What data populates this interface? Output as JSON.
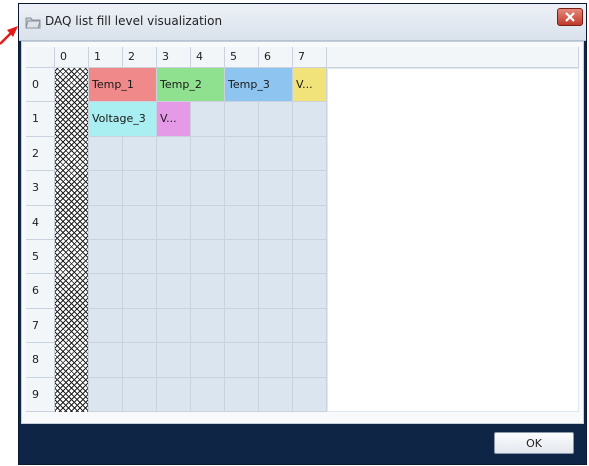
{
  "window": {
    "title": "DAQ list fill level visualization",
    "ok_label": "OK"
  },
  "grid": {
    "column_headers": [
      "0",
      "1",
      "2",
      "3",
      "4",
      "5",
      "6",
      "7"
    ],
    "row_headers": [
      "0",
      "1",
      "2",
      "3",
      "4",
      "5",
      "6",
      "7",
      "8",
      "9"
    ],
    "signals": [
      {
        "label": "Temp_1",
        "row": 0,
        "col_start": 1,
        "col_span": 2,
        "color": "#f08a8a"
      },
      {
        "label": "Temp_2",
        "row": 0,
        "col_start": 3,
        "col_span": 2,
        "color": "#8fe08f"
      },
      {
        "label": "Temp_3",
        "row": 0,
        "col_start": 5,
        "col_span": 2,
        "color": "#8ec4f0"
      },
      {
        "label": "V...",
        "row": 0,
        "col_start": 7,
        "col_span": 1,
        "color": "#f2e27a"
      },
      {
        "label": "Voltage_3",
        "row": 1,
        "col_start": 1,
        "col_span": 2,
        "color": "#a9eef0"
      },
      {
        "label": "V...",
        "row": 1,
        "col_start": 3,
        "col_span": 1,
        "color": "#e59ae8"
      }
    ]
  },
  "colors": {
    "cell_fill": "#dbe5ef",
    "window_frame": "#0f2545"
  }
}
